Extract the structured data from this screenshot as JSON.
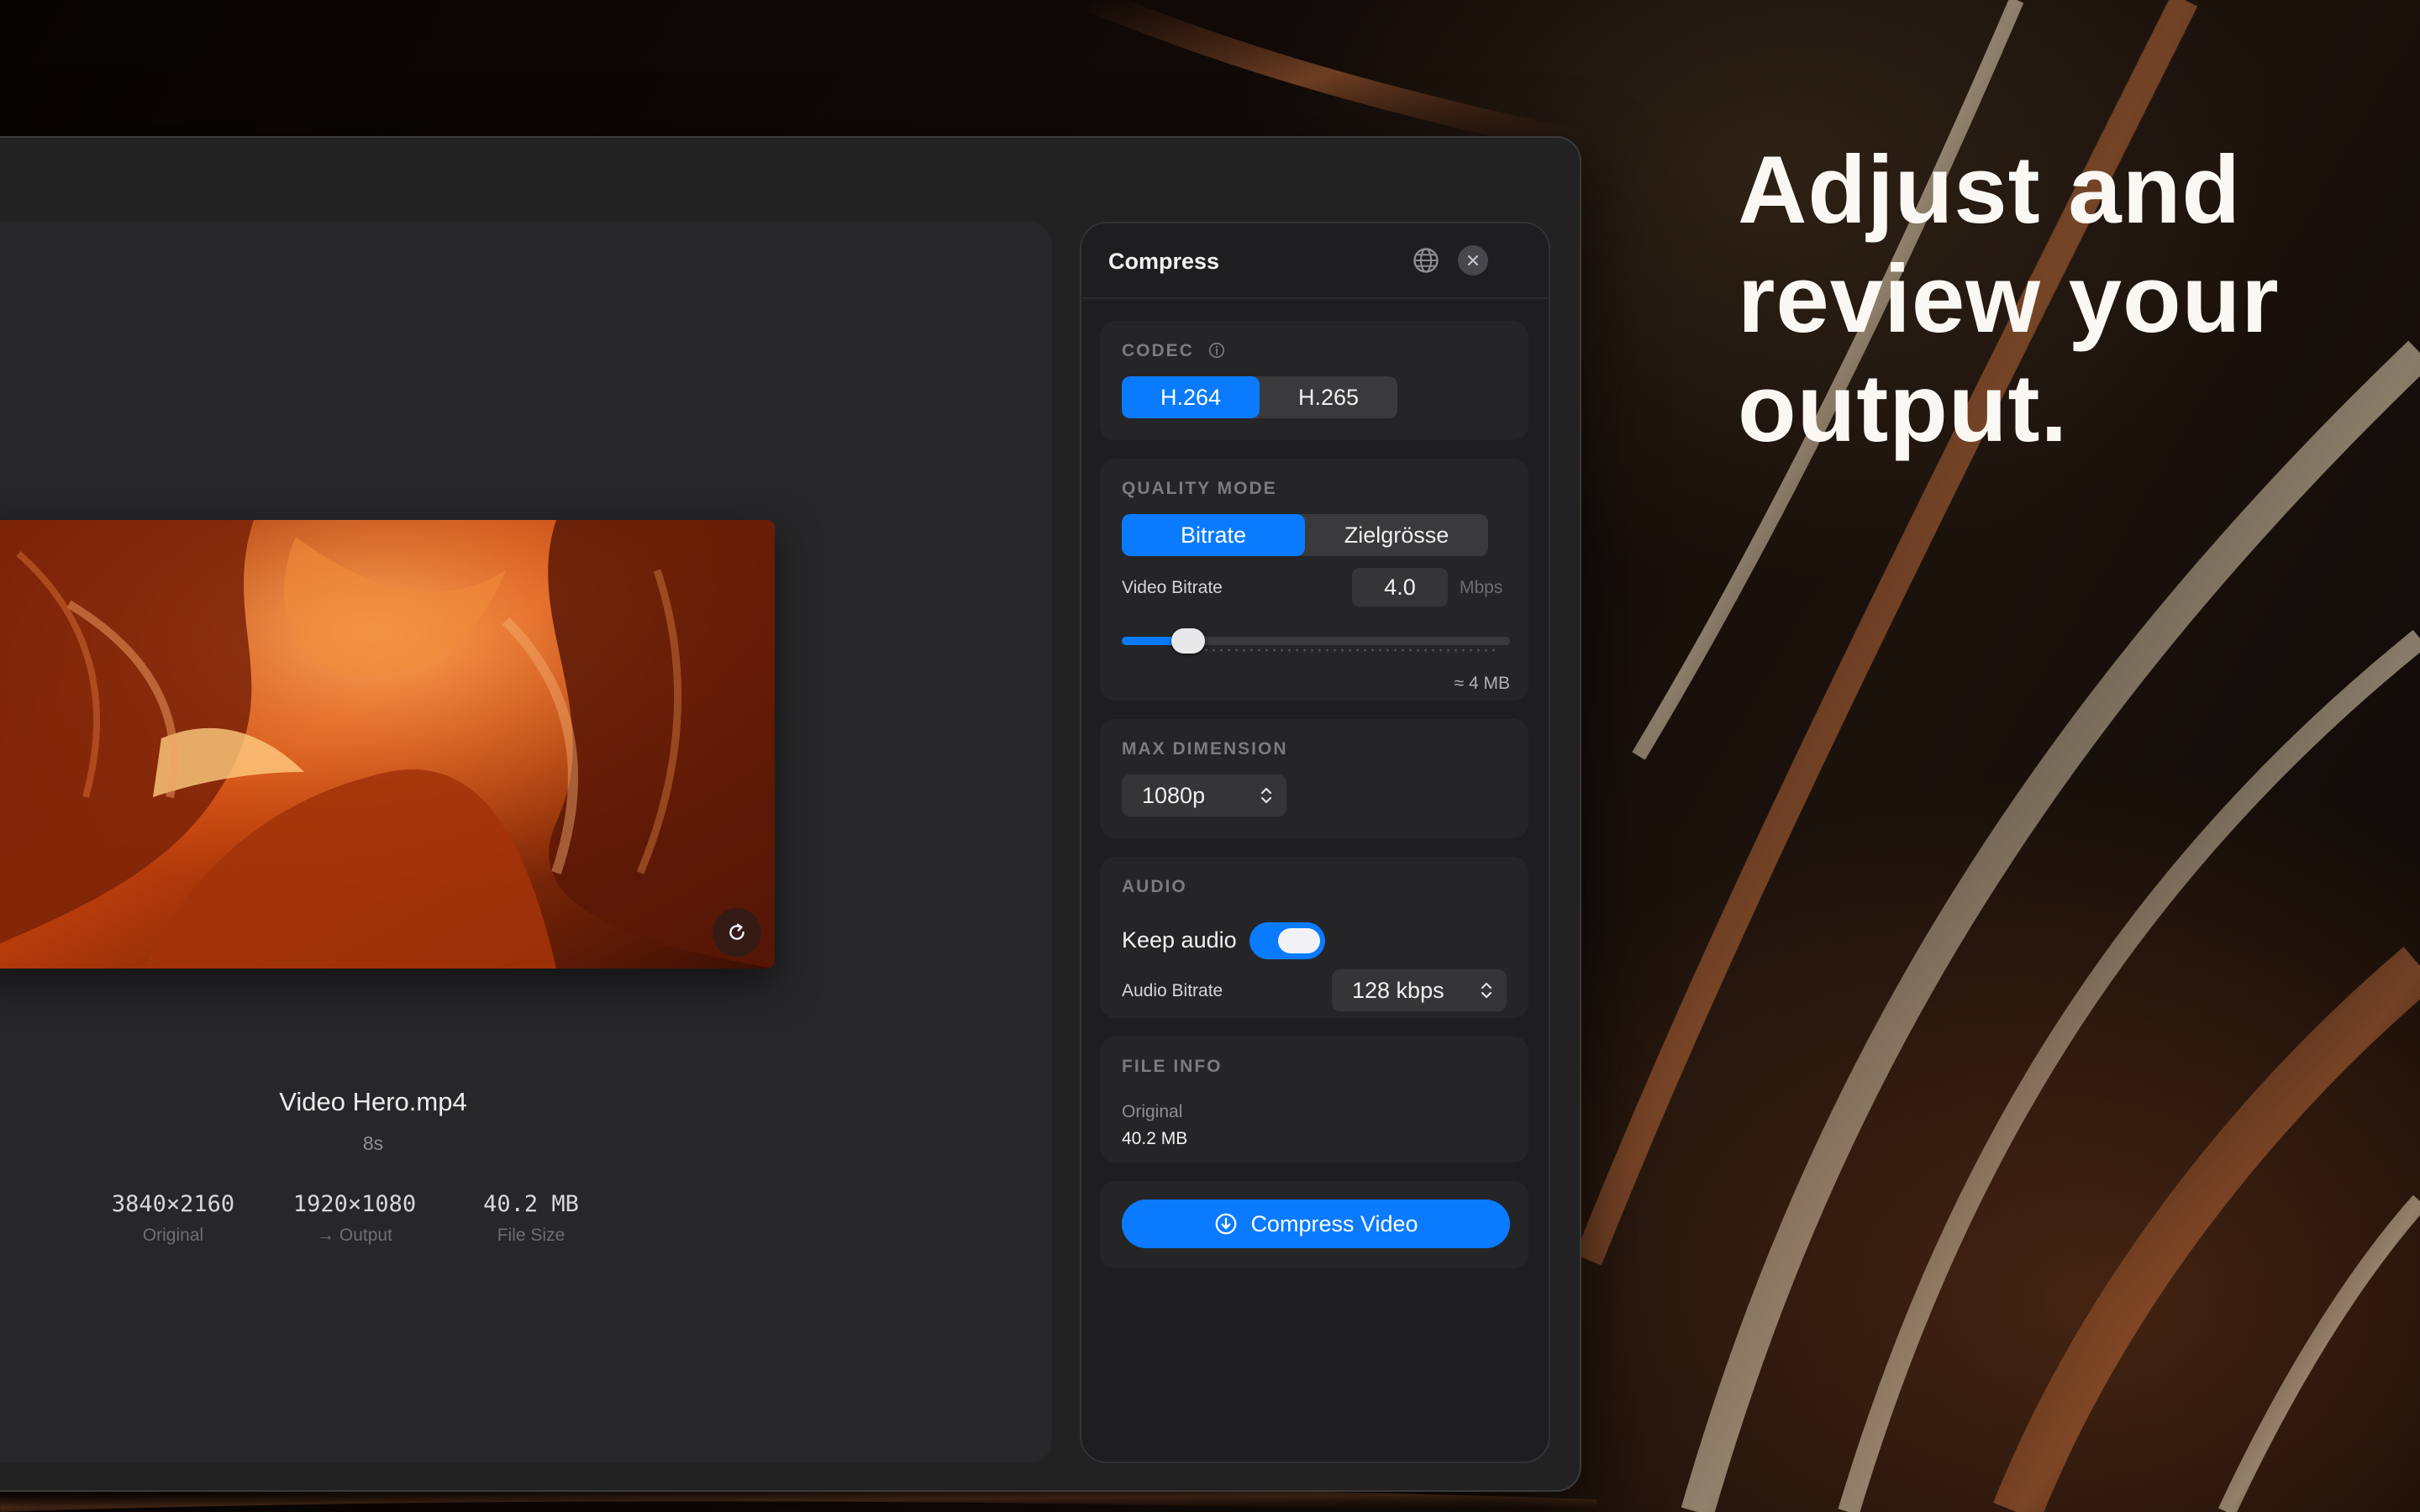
{
  "headline": {
    "line1": "Adjust and",
    "line2": "review your",
    "line3": "output."
  },
  "preview": {
    "file_name": "Video Hero.mp4",
    "duration": "8s",
    "meta": [
      {
        "value": "3840×2160",
        "label": "Original"
      },
      {
        "value": "1920×1080",
        "label": "→ Output"
      },
      {
        "value": "40.2 MB",
        "label": "File Size"
      }
    ],
    "replay_icon": "refresh-icon"
  },
  "panel": {
    "title": "Compress",
    "globe_icon": "globe-icon",
    "close_icon": "close-icon",
    "codec": {
      "label": "CODEC",
      "info_icon": "info-icon",
      "options": [
        "H.264",
        "H.265"
      ],
      "selected": "H.264"
    },
    "quality": {
      "label": "QUALITY MODE",
      "options": [
        "Bitrate",
        "Zielgrösse"
      ],
      "selected": "Bitrate",
      "bitrate_label": "Video Bitrate",
      "bitrate_value": "4.0",
      "bitrate_unit": "Mbps",
      "slider_fraction": 0.15,
      "estimate": "≈ 4 MB"
    },
    "max_dimension": {
      "label": "MAX DIMENSION",
      "value": "1080p"
    },
    "audio": {
      "label": "AUDIO",
      "keep_audio_label": "Keep audio",
      "keep_audio_on": true,
      "bitrate_label": "Audio Bitrate",
      "bitrate_value": "128 kbps"
    },
    "file_info": {
      "label": "FILE INFO",
      "original_label": "Original",
      "original_value": "40.2 MB"
    },
    "compress_button": {
      "label": "Compress Video",
      "icon": "download-circle-icon"
    }
  },
  "colors": {
    "accent": "#0a7bff",
    "panel_bg": "#1e1e20",
    "window_bg": "#222223"
  }
}
